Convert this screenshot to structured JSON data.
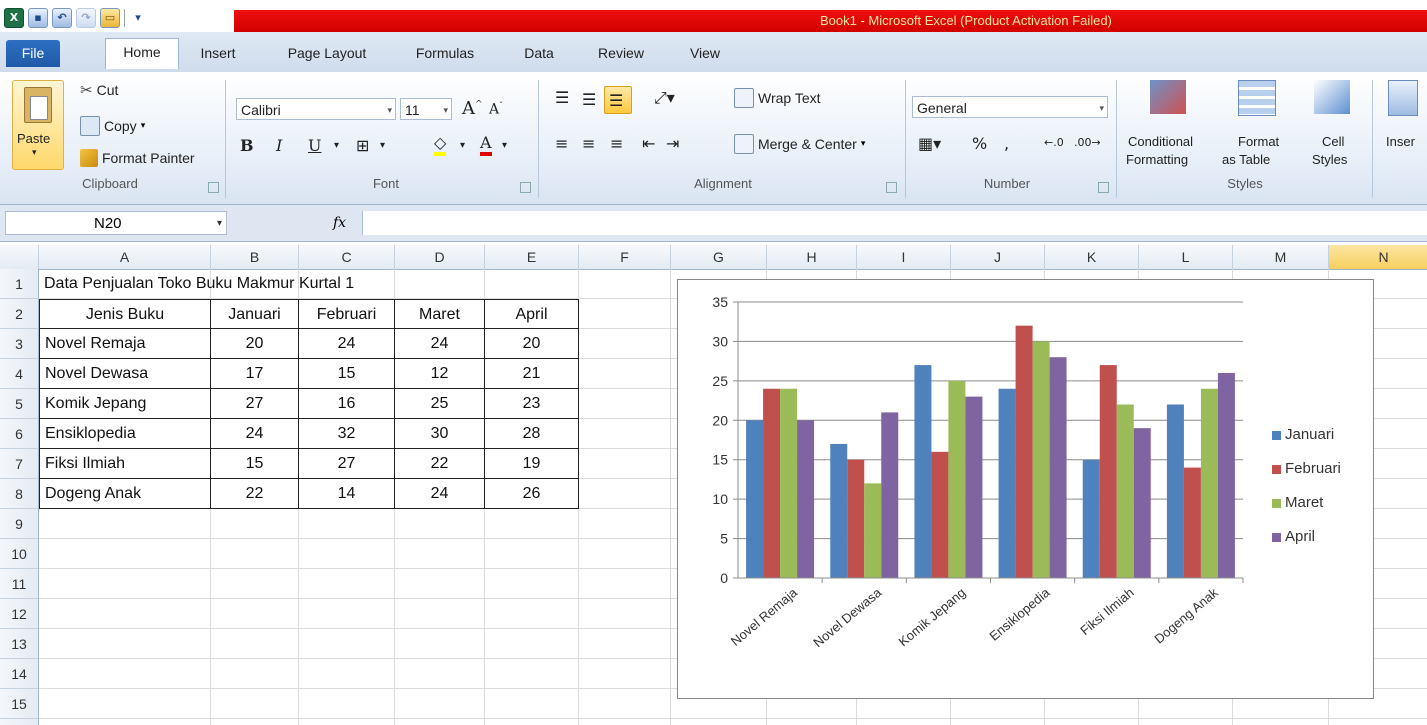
{
  "window": {
    "title": "Book1  -  Microsoft Excel (Product Activation Failed)"
  },
  "ribbon_tabs": [
    "File",
    "Home",
    "Insert",
    "Page Layout",
    "Formulas",
    "Data",
    "Review",
    "View"
  ],
  "clipboard": {
    "paste": "Paste",
    "cut": "Cut",
    "copy": "Copy",
    "format_painter": "Format Painter",
    "label": "Clipboard"
  },
  "font": {
    "name": "Calibri",
    "size": "11",
    "label": "Font"
  },
  "alignment": {
    "wrap_text": "Wrap Text",
    "merge_center": "Merge & Center",
    "label": "Alignment"
  },
  "number": {
    "format": "General",
    "label": "Number"
  },
  "styles": {
    "conditional_line1": "Conditional",
    "conditional_line2": "Formatting",
    "format_table_line1": "Format",
    "format_table_line2": "as Table",
    "cell_styles_line1": "Cell",
    "cell_styles_line2": "Styles",
    "label": "Styles"
  },
  "insert_partial": "Inser",
  "formula_bar": {
    "name_box": "N20",
    "fx": "fx",
    "value": ""
  },
  "columns": [
    "A",
    "B",
    "C",
    "D",
    "E",
    "F",
    "G",
    "H",
    "I",
    "J",
    "K",
    "L",
    "M",
    "N"
  ],
  "selected_column": "N",
  "rows": [
    "1",
    "2",
    "3",
    "4",
    "5",
    "6",
    "7",
    "8",
    "9",
    "10",
    "11",
    "12",
    "13",
    "14",
    "15",
    "16"
  ],
  "sheet": {
    "title": "Data Penjualan Toko Buku Makmur Kurtal 1",
    "headers": [
      "Jenis Buku",
      "Januari",
      "Februari",
      "Maret",
      "April"
    ],
    "table": [
      [
        "Novel Remaja",
        "20",
        "24",
        "24",
        "20"
      ],
      [
        "Novel Dewasa",
        "17",
        "15",
        "12",
        "21"
      ],
      [
        "Komik Jepang",
        "27",
        "16",
        "25",
        "23"
      ],
      [
        "Ensiklopedia",
        "24",
        "32",
        "30",
        "28"
      ],
      [
        "Fiksi Ilmiah",
        "15",
        "27",
        "22",
        "19"
      ],
      [
        "Dogeng Anak",
        "22",
        "14",
        "24",
        "26"
      ]
    ]
  },
  "colors": {
    "januari": "#4f81bd",
    "februari": "#c0504d",
    "maret": "#9bbb59",
    "april": "#8064a2"
  },
  "chart_data": {
    "type": "bar",
    "categories": [
      "Novel Remaja",
      "Novel Dewasa",
      "Komik Jepang",
      "Ensiklopedia",
      "Fiksi Ilmiah",
      "Dogeng Anak"
    ],
    "series": [
      {
        "name": "Januari",
        "values": [
          20,
          17,
          27,
          24,
          15,
          22
        ]
      },
      {
        "name": "Februari",
        "values": [
          24,
          15,
          16,
          32,
          27,
          14
        ]
      },
      {
        "name": "Maret",
        "values": [
          24,
          12,
          25,
          30,
          22,
          24
        ]
      },
      {
        "name": "April",
        "values": [
          20,
          21,
          23,
          28,
          19,
          26
        ]
      }
    ],
    "yticks": [
      "0",
      "5",
      "10",
      "15",
      "20",
      "25",
      "30",
      "35"
    ],
    "ylim": [
      0,
      35
    ],
    "grid": true,
    "legend_position": "right"
  }
}
